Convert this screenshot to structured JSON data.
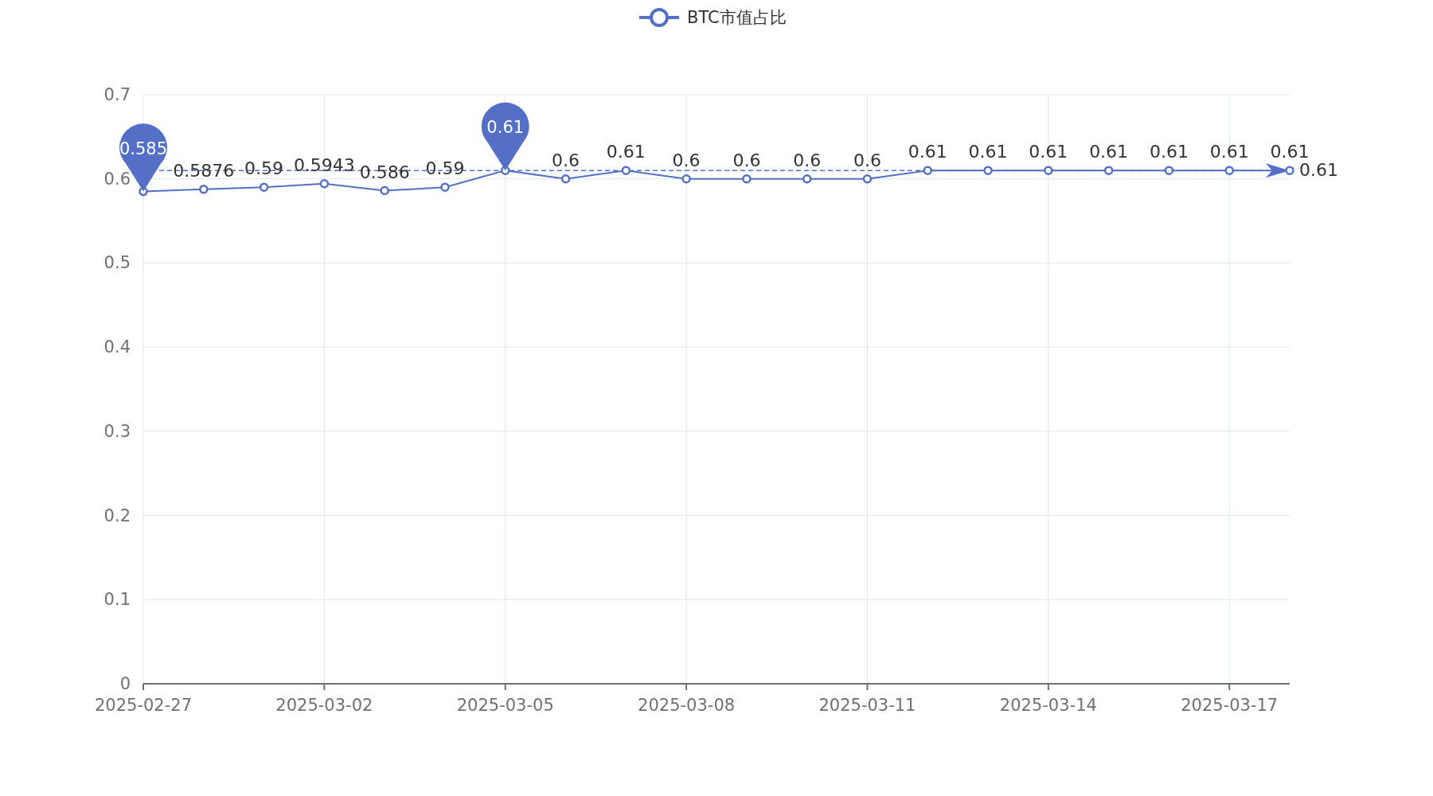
{
  "chart_data": {
    "type": "line",
    "categories": [
      "2025-02-27",
      null,
      null,
      "2025-03-02",
      null,
      null,
      "2025-03-05",
      null,
      null,
      "2025-03-08",
      null,
      null,
      "2025-03-11",
      null,
      null,
      "2025-03-14",
      null,
      null,
      "2025-03-17",
      null
    ],
    "series": [
      {
        "name": "BTC市值占比",
        "color": "#5470c6",
        "marker": "circle",
        "values": [
          0.585,
          0.5876,
          0.59,
          0.5943,
          0.586,
          0.59,
          0.61,
          0.6,
          0.61,
          0.6,
          0.6,
          0.6,
          0.6,
          0.61,
          0.61,
          0.61,
          0.61,
          0.61,
          0.61,
          0.61
        ]
      }
    ],
    "ylim": [
      0,
      0.7
    ],
    "yticks": [
      0,
      0.1,
      0.2,
      0.3,
      0.4,
      0.5,
      0.6,
      0.7
    ],
    "grid": true,
    "value_labels": [
      null,
      "0.5876",
      "0.59",
      "0.5943",
      "0.586",
      "0.59",
      null,
      "0.6",
      "0.61",
      "0.6",
      "0.6",
      "0.6",
      "0.6",
      "0.61",
      "0.61",
      "0.61",
      "0.61",
      "0.61",
      "0.61",
      "0.61"
    ],
    "ref_lines": [
      {
        "axis": "y",
        "value": 0.61,
        "label": "0.61"
      }
    ],
    "annotations": [
      {
        "text": "0.585",
        "x": "2025-02-27",
        "y": 0.585
      },
      {
        "text": "0.61",
        "x": "2025-03-05",
        "y": 0.61
      }
    ]
  }
}
